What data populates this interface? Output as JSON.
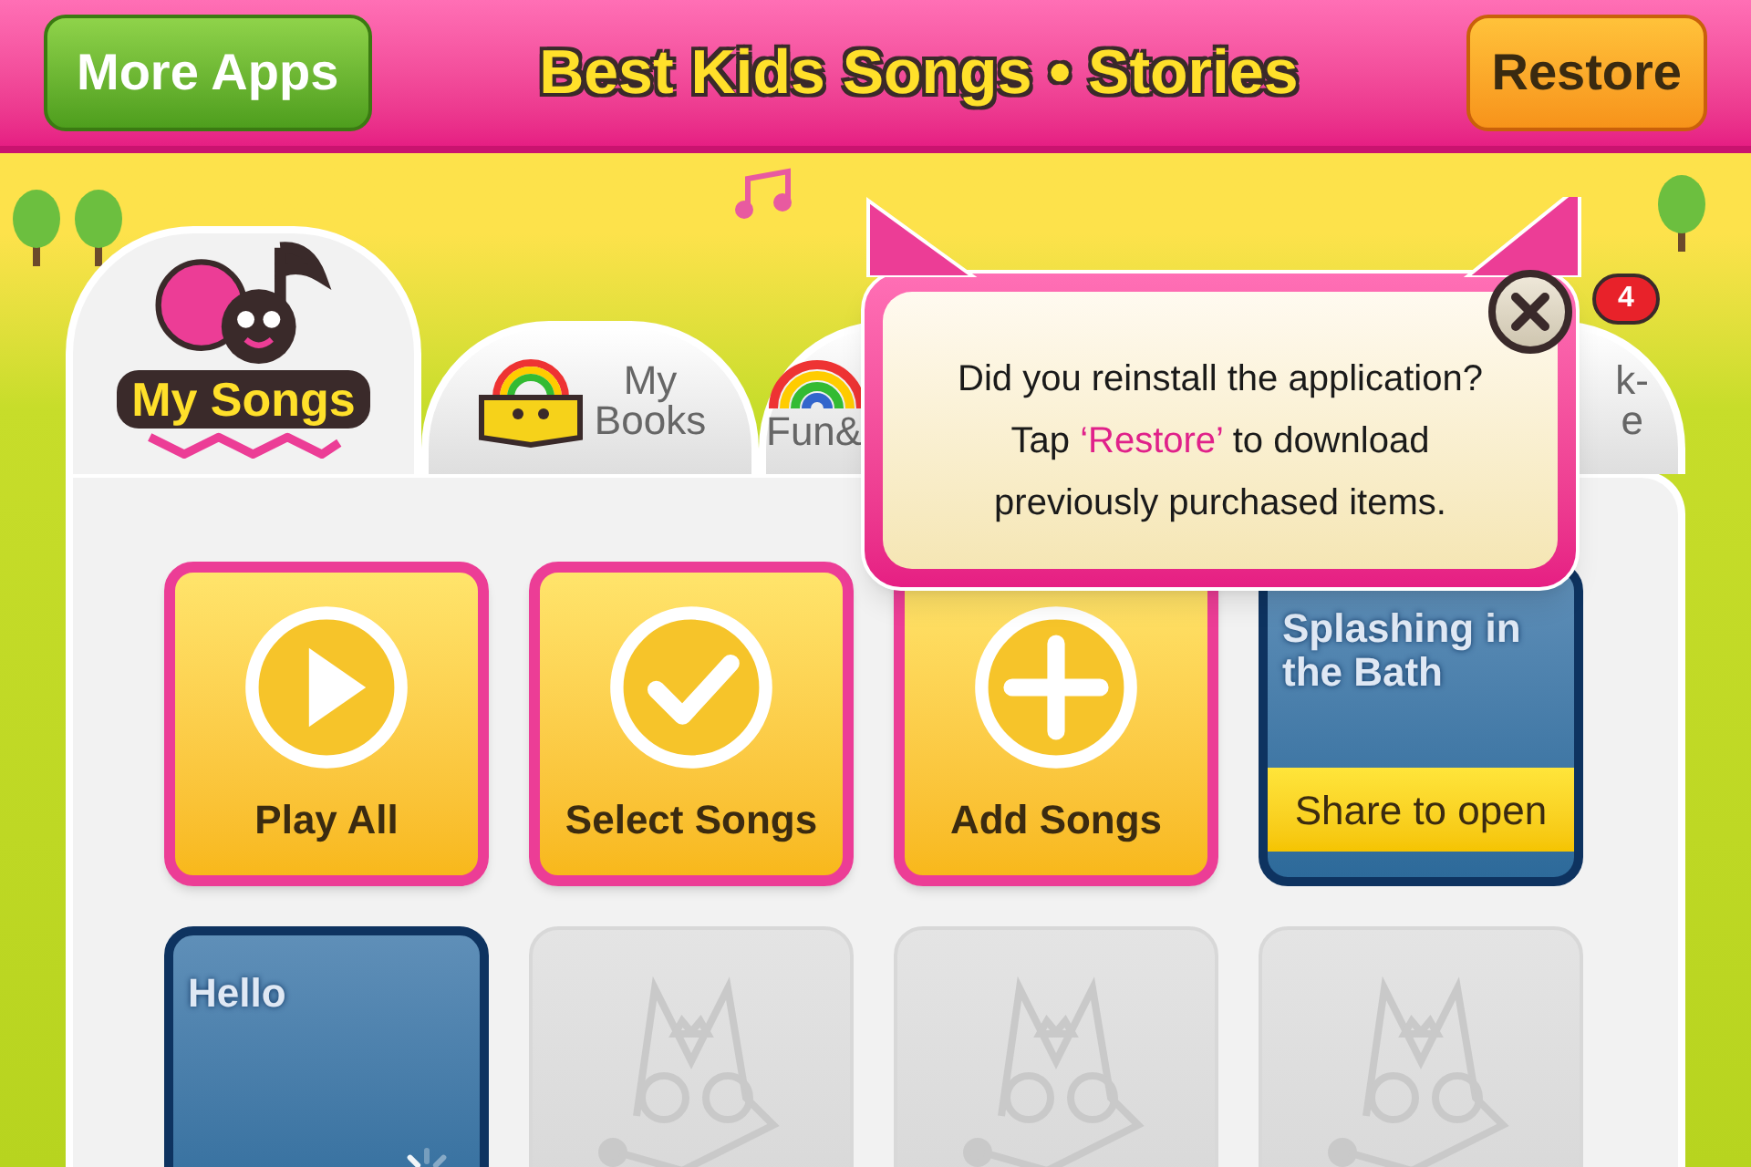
{
  "header": {
    "more_apps": "More Apps",
    "title": "Best Kids Songs • Stories",
    "restore": "Restore"
  },
  "tabs": [
    {
      "lines": [
        "My Songs"
      ],
      "selected": true
    },
    {
      "lines": [
        "My",
        "Books"
      ],
      "selected": false
    },
    {
      "lines": [
        "Fun&"
      ],
      "selected": false
    },
    {
      "lines": [
        "k-",
        "e"
      ],
      "selected": false,
      "badge": "4"
    }
  ],
  "popup": {
    "line_1": "Did you reinstall the application?",
    "before": "Tap",
    "highlight": "‘Restore’",
    "after": "to download",
    "line_3": "previously purchased items."
  },
  "cards": [
    {
      "kind": "action",
      "label": "Play All"
    },
    {
      "kind": "action",
      "label": "Select Songs"
    },
    {
      "kind": "action",
      "label": "Add Songs"
    },
    {
      "kind": "song",
      "title": "Splashing in the Bath",
      "banner": "Share to open",
      "loading": false
    },
    {
      "kind": "song",
      "title": "Hello",
      "loading": true
    },
    {
      "kind": "locked"
    },
    {
      "kind": "locked"
    },
    {
      "kind": "locked"
    }
  ]
}
